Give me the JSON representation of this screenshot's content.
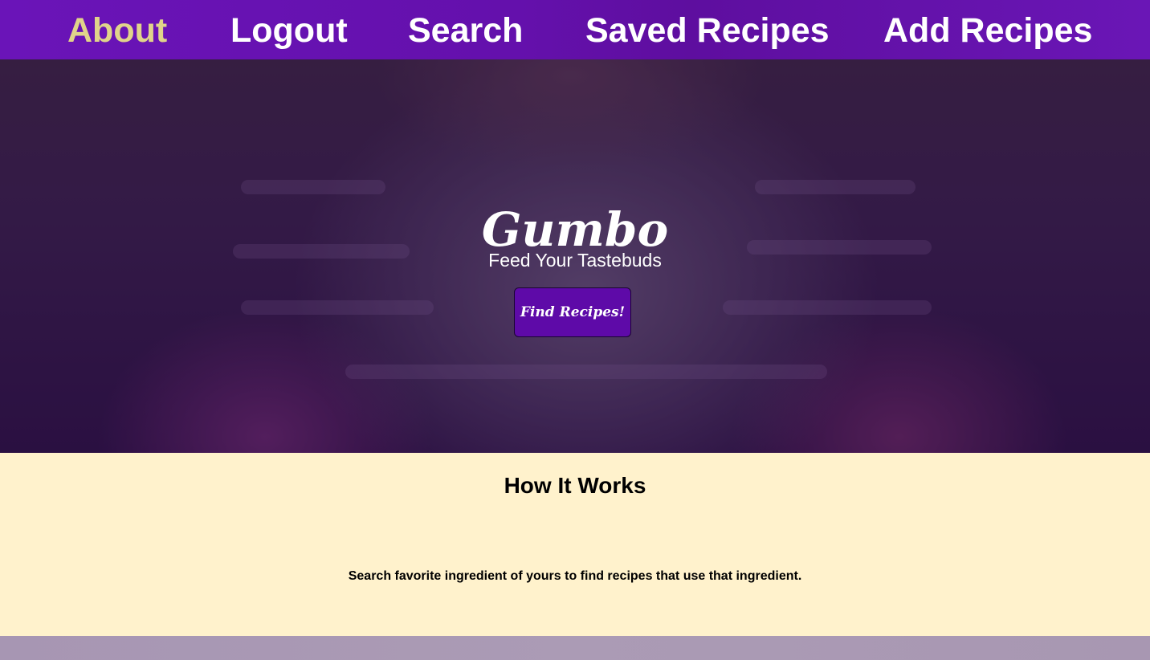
{
  "nav": {
    "items": [
      {
        "label": "About",
        "active": true
      },
      {
        "label": "Logout",
        "active": false
      },
      {
        "label": "Search",
        "active": false
      },
      {
        "label": "Saved Recipes",
        "active": false
      },
      {
        "label": "Add Recipes",
        "active": false
      }
    ],
    "colors": {
      "background": "#6410ac",
      "text": "#ffffff",
      "active_text": "#e0d48a"
    }
  },
  "hero": {
    "title": "Gumbo",
    "subtitle": "Feed Your Tastebuds",
    "cta_label": "Find Recipes!",
    "cta_color": "#5e0aa8"
  },
  "how_it_works": {
    "title": "How It Works",
    "text": "Search favorite ingredient of yours to find recipes that use that ingredient.",
    "background": "#fff2cc"
  }
}
